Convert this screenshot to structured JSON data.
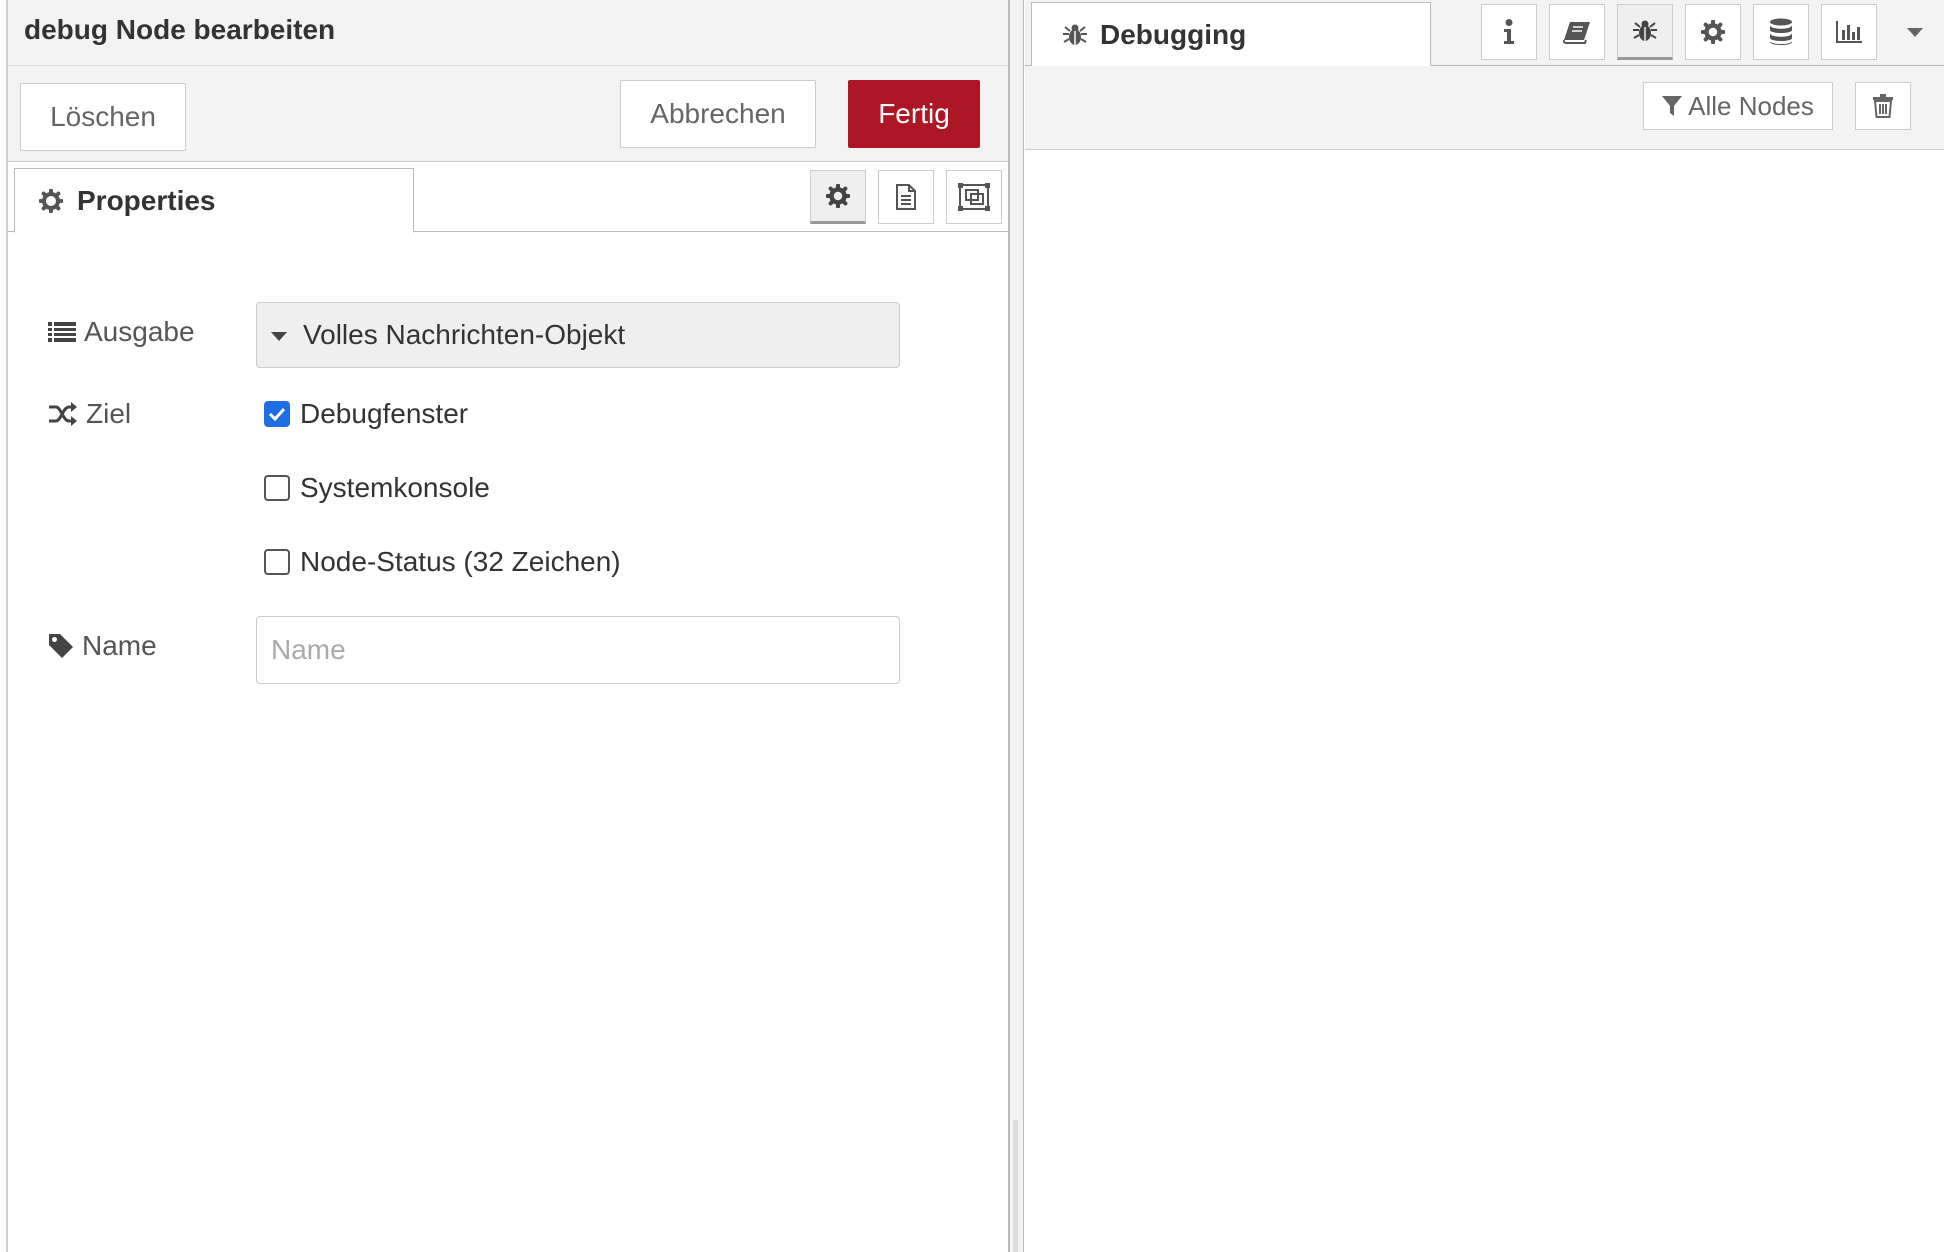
{
  "tray": {
    "title": "debug Node bearbeiten",
    "buttons": {
      "delete": "Löschen",
      "cancel": "Abbrechen",
      "done": "Fertig"
    },
    "tabs": {
      "properties": "Properties"
    },
    "form": {
      "output_label": "Ausgabe",
      "output_value": "Volles Nachrichten-Objekt",
      "target_label": "Ziel",
      "targets": [
        {
          "label": "Debugfenster",
          "checked": true
        },
        {
          "label": "Systemkonsole",
          "checked": false
        },
        {
          "label": "Node-Status (32 Zeichen)",
          "checked": false
        }
      ],
      "name_label": "Name",
      "name_placeholder": "Name",
      "name_value": ""
    }
  },
  "sidebar": {
    "active_tab": "Debugging",
    "tab_icons": [
      "info-icon",
      "book-icon",
      "bug-icon",
      "gear-icon",
      "database-icon",
      "bar-chart-icon"
    ],
    "filter_label": "Alle Nodes"
  },
  "colors": {
    "primary_button": "#ad1625",
    "checkbox_checked": "#1f6fe3"
  }
}
